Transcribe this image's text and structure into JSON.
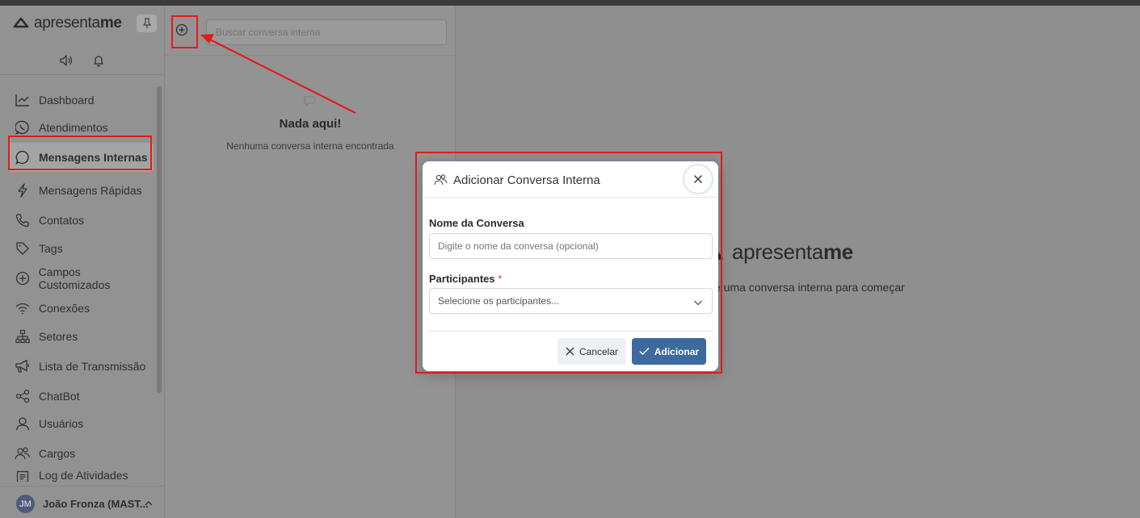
{
  "sidebar": {
    "brand_light": "apresenta",
    "brand_bold": "me",
    "items": [
      {
        "label": "Dashboard",
        "icon": "chart-line-icon"
      },
      {
        "label": "Atendimentos",
        "icon": "whatsapp-icon"
      },
      {
        "label": "Mensagens Internas",
        "icon": "chat-bubble-icon"
      },
      {
        "label": "Mensagens Rápidas",
        "icon": "lightning-icon"
      },
      {
        "label": "Contatos",
        "icon": "phone-icon"
      },
      {
        "label": "Tags",
        "icon": "tag-icon"
      },
      {
        "label": "Campos Customizados",
        "icon": "plus-circle-icon"
      },
      {
        "label": "Conexões",
        "icon": "wifi-icon"
      },
      {
        "label": "Setores",
        "icon": "hierarchy-icon"
      },
      {
        "label": "Lista de Transmissão",
        "icon": "megaphone-icon"
      },
      {
        "label": "ChatBot",
        "icon": "share-nodes-icon"
      },
      {
        "label": "Usuários",
        "icon": "user-icon"
      },
      {
        "label": "Cargos",
        "icon": "users-icon"
      },
      {
        "label": "Log de Atividades",
        "icon": "list-icon"
      }
    ],
    "active_index": 2,
    "user": {
      "initials": "JM",
      "name": "João Fronza (MAST..."
    }
  },
  "conversations": {
    "search_placeholder": "Buscar conversa interna",
    "empty_title": "Nada aqui!",
    "empty_subtitle": "Nenhuma conversa interna encontrada"
  },
  "main": {
    "brand_light": "apresenta",
    "brand_bold": "me",
    "hint": "e uma conversa interna para começar"
  },
  "modal": {
    "title": "Adicionar Conversa Interna",
    "name_label": "Nome da Conversa",
    "name_placeholder": "Digite o nome da conversa (opcional)",
    "participants_label": "Participantes",
    "required_mark": "*",
    "participants_placeholder": "Selecione os participantes...",
    "cancel_label": "Cancelar",
    "add_label": "Adicionar"
  },
  "colors": {
    "accent": "#3c6a9f",
    "annotation": "#e31b1b",
    "required": "#e0393e"
  }
}
